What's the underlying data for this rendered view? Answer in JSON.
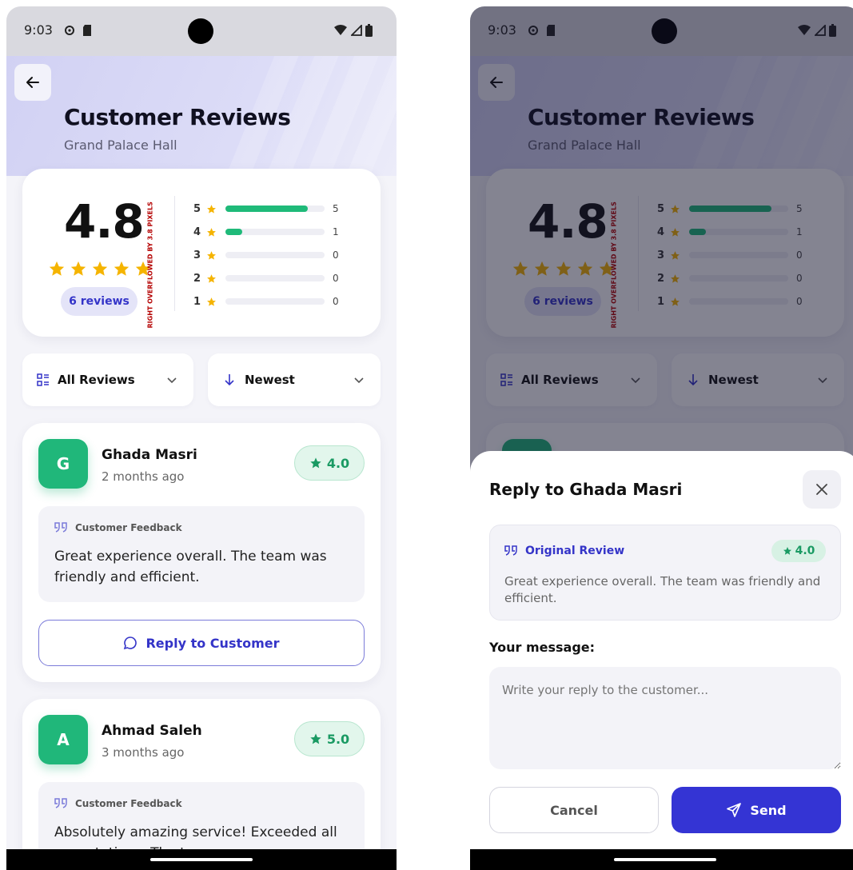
{
  "status_bar": {
    "time": "9:03"
  },
  "screen": {
    "title": "Customer Reviews",
    "subtitle": "Grand Palace Hall"
  },
  "summary": {
    "average": "4.8",
    "star_rating": 4.8,
    "reviews_count_label": "6 reviews",
    "overflow_warning": "RIGHT OVERFLOWED BY 3.8 PIXELS",
    "breakdown": [
      {
        "stars": "5",
        "count": "5",
        "fraction": 0.83
      },
      {
        "stars": "4",
        "count": "1",
        "fraction": 0.17
      },
      {
        "stars": "3",
        "count": "0",
        "fraction": 0
      },
      {
        "stars": "2",
        "count": "0",
        "fraction": 0
      },
      {
        "stars": "1",
        "count": "0",
        "fraction": 0
      }
    ]
  },
  "filters": {
    "category": "All Reviews",
    "sort": "Newest"
  },
  "reviews": [
    {
      "initial": "G",
      "name": "Ghada Masri",
      "time": "2 months ago",
      "rating": "4.0",
      "feedback_label": "Customer Feedback",
      "text": "Great experience overall. The team was friendly and efficient.",
      "reply_label": "Reply to Customer"
    },
    {
      "initial": "A",
      "name": "Ahmad Saleh",
      "time": "3 months ago",
      "rating": "5.0",
      "feedback_label": "Customer Feedback",
      "text": "Absolutely amazing service! Exceeded all expectations. The t"
    }
  ],
  "reply_sheet": {
    "title": "Reply to Ghada Masri",
    "original_label": "Original Review",
    "original_rating": "4.0",
    "original_text": "Great experience overall. The team was friendly and efficient.",
    "message_label": "Your message:",
    "placeholder": "Write your reply to the customer...",
    "cancel_label": "Cancel",
    "send_label": "Send"
  },
  "colors": {
    "accent": "#3434d4",
    "green": "#20b77a",
    "star": "#f5b400"
  }
}
